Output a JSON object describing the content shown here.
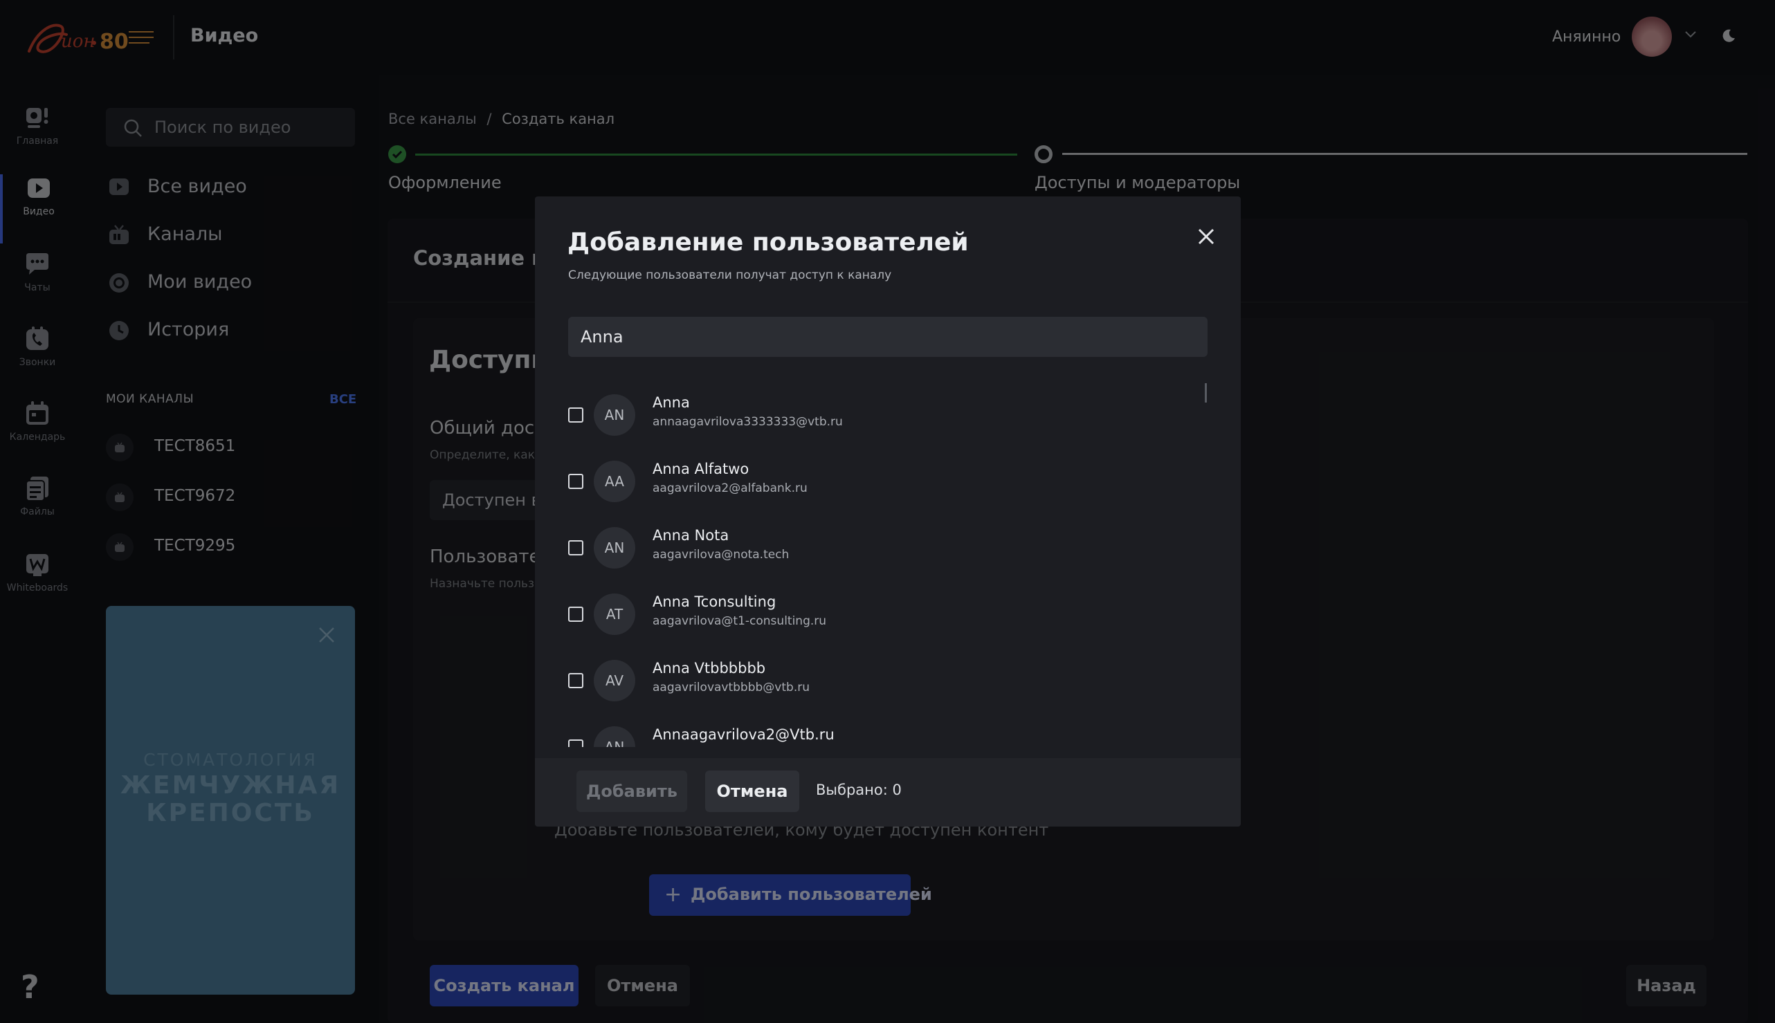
{
  "header": {
    "app_title": "Видео",
    "user_name": "Аняинно",
    "logo_label": "Дион · 80 лет со дня победы"
  },
  "rail": [
    {
      "label": "Главная",
      "icon": "home-camera-icon"
    },
    {
      "label": "Видео",
      "icon": "video-play-icon",
      "active": true
    },
    {
      "label": "Чаты",
      "icon": "chat-icon"
    },
    {
      "label": "Звонки",
      "icon": "phone-icon"
    },
    {
      "label": "Календарь",
      "icon": "calendar-icon"
    },
    {
      "label": "Файлы",
      "icon": "files-icon"
    },
    {
      "label": "Whiteboards",
      "icon": "whiteboard-icon"
    }
  ],
  "help_label": "?",
  "sidebar": {
    "search_placeholder": "Поиск по видео",
    "nav": [
      {
        "label": "Все видео",
        "icon": "play-circle-icon"
      },
      {
        "label": "Каналы",
        "icon": "tv-icon"
      },
      {
        "label": "Мои видео",
        "icon": "record-icon"
      },
      {
        "label": "История",
        "icon": "clock-icon"
      }
    ],
    "my_channels_title": "МОИ КАНАЛЫ",
    "my_channels_all": "ВСЕ",
    "channels": [
      "ТЕСТ8651",
      "ТЕСТ9672",
      "ТЕСТ9295"
    ],
    "promo": {
      "line1": "СТОМАТОЛОГИЯ",
      "line2": "ЖЕМЧУЖНАЯ",
      "line3": "КРЕПОСТЬ"
    }
  },
  "main": {
    "breadcrumb_root": "Все каналы",
    "breadcrumb_sep": "/",
    "breadcrumb_current": "Создать канал",
    "step1": "Оформление",
    "step2": "Доступы и модераторы",
    "card_title": "Создание канала",
    "section_title": "Доступы",
    "common_access_label": "Общий доступ",
    "common_access_hint": "Определите, как",
    "common_access_value": "Доступен вс",
    "users_label": "Пользователи",
    "users_hint": "Назначьте пользо",
    "add_hint": "Добавьте пользователей, кому будет доступен контент",
    "add_users_btn": "Добавить пользователей",
    "create_btn": "Создать канал",
    "cancel_btn": "Отмена",
    "back_btn": "Назад"
  },
  "modal": {
    "title": "Добавление пользователей",
    "subtitle": "Следующие пользователи получат доступ к каналу",
    "search_value": "Anna",
    "users": [
      {
        "initials": "AN",
        "name": "Anna",
        "email": "annaagavrilova3333333@vtb.ru"
      },
      {
        "initials": "AA",
        "name": "Anna Alfatwo",
        "email": "aagavrilova2@alfabank.ru"
      },
      {
        "initials": "AN",
        "name": "Anna Nota",
        "email": "aagavrilova@nota.tech"
      },
      {
        "initials": "AT",
        "name": "Anna Tconsulting",
        "email": "aagavrilova@t1-consulting.ru"
      },
      {
        "initials": "AV",
        "name": "Anna Vtbbbbbb",
        "email": "aagavrilovavtbbbb@vtb.ru"
      },
      {
        "initials": "AN",
        "name": "Annaagavrilova2@Vtb.ru",
        "email": ""
      }
    ],
    "add_btn": "Добавить",
    "cancel_btn": "Отмена",
    "selected_text": "Выбрано: 0"
  },
  "colors": {
    "accent": "#2c47b8",
    "success": "#3a9a48",
    "link": "#4d79f3"
  }
}
